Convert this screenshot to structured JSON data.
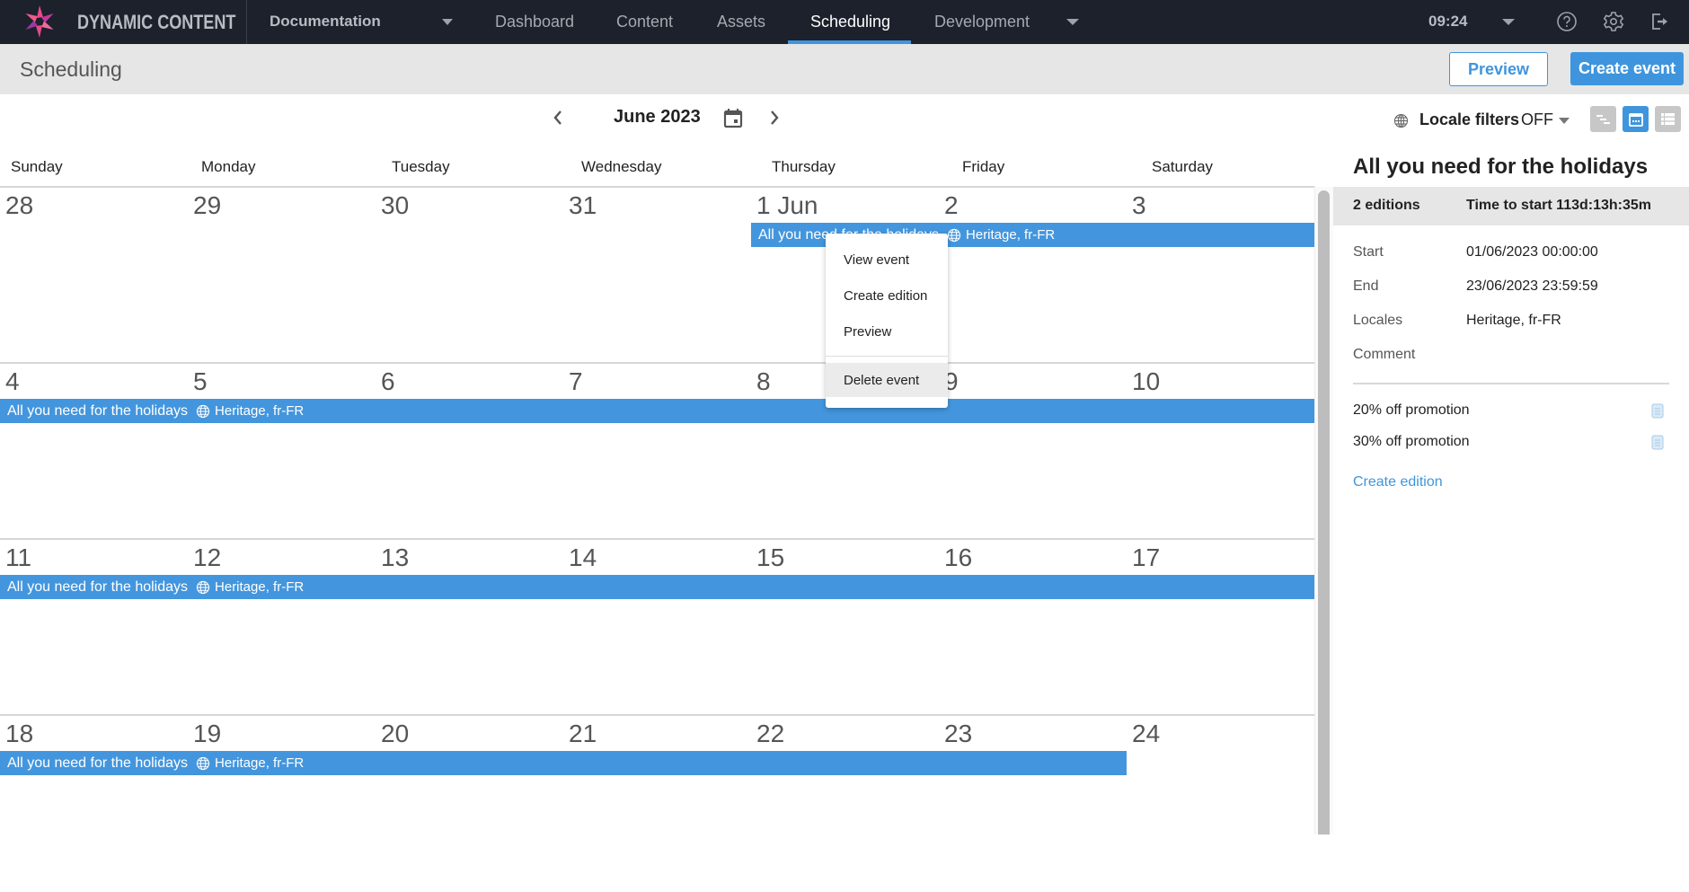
{
  "app": {
    "brand": "DYNAMIC CONTENT",
    "hub": "Documentation",
    "nav": [
      "Dashboard",
      "Content",
      "Assets",
      "Scheduling",
      "Development"
    ],
    "active_nav": "Scheduling",
    "clock": "09:24",
    "icons": [
      "help-icon",
      "settings-gear-icon",
      "logout-icon"
    ]
  },
  "subheader": {
    "title": "Scheduling",
    "preview_label": "Preview",
    "create_event_label": "Create event"
  },
  "toolbar": {
    "month": "June 2023",
    "locale_filters_label": "Locale filters",
    "locale_filters_value": "OFF",
    "views": [
      "timeline-view",
      "calendar-view",
      "list-view"
    ],
    "active_view": "calendar-view"
  },
  "calendar": {
    "weekdays": [
      "Sunday",
      "Monday",
      "Tuesday",
      "Wednesday",
      "Thursday",
      "Friday",
      "Saturday"
    ],
    "weeks": [
      [
        "28",
        "29",
        "30",
        "31",
        "1 Jun",
        "2",
        "3"
      ],
      [
        "4",
        "5",
        "6",
        "7",
        "8",
        "9",
        "10"
      ],
      [
        "11",
        "12",
        "13",
        "14",
        "15",
        "16",
        "17"
      ],
      [
        "18",
        "19",
        "20",
        "21",
        "22",
        "23",
        "24"
      ]
    ],
    "event": {
      "name": "All you need for the holidays",
      "locales": "Heritage, fr-FR",
      "color": "#4396dd"
    }
  },
  "context_menu": {
    "items": [
      "View event",
      "Create edition",
      "Preview",
      "Delete event"
    ],
    "hovered": "Delete event"
  },
  "side_panel": {
    "title": "All you need for the holidays",
    "editions_count": "2 editions",
    "time_to_start": "Time to start 113d:13h:35m",
    "fields": [
      {
        "label": "Start",
        "value": "01/06/2023 00:00:00"
      },
      {
        "label": "End",
        "value": "23/06/2023 23:59:59"
      },
      {
        "label": "Locales",
        "value": "Heritage, fr-FR"
      },
      {
        "label": "Comment",
        "value": ""
      }
    ],
    "editions": [
      "20% off promotion",
      "30% off promotion"
    ],
    "create_edition_label": "Create edition"
  },
  "colors": {
    "accent": "#3f95dd",
    "topbar": "#1c212c",
    "subbar": "#e6e6e6"
  }
}
